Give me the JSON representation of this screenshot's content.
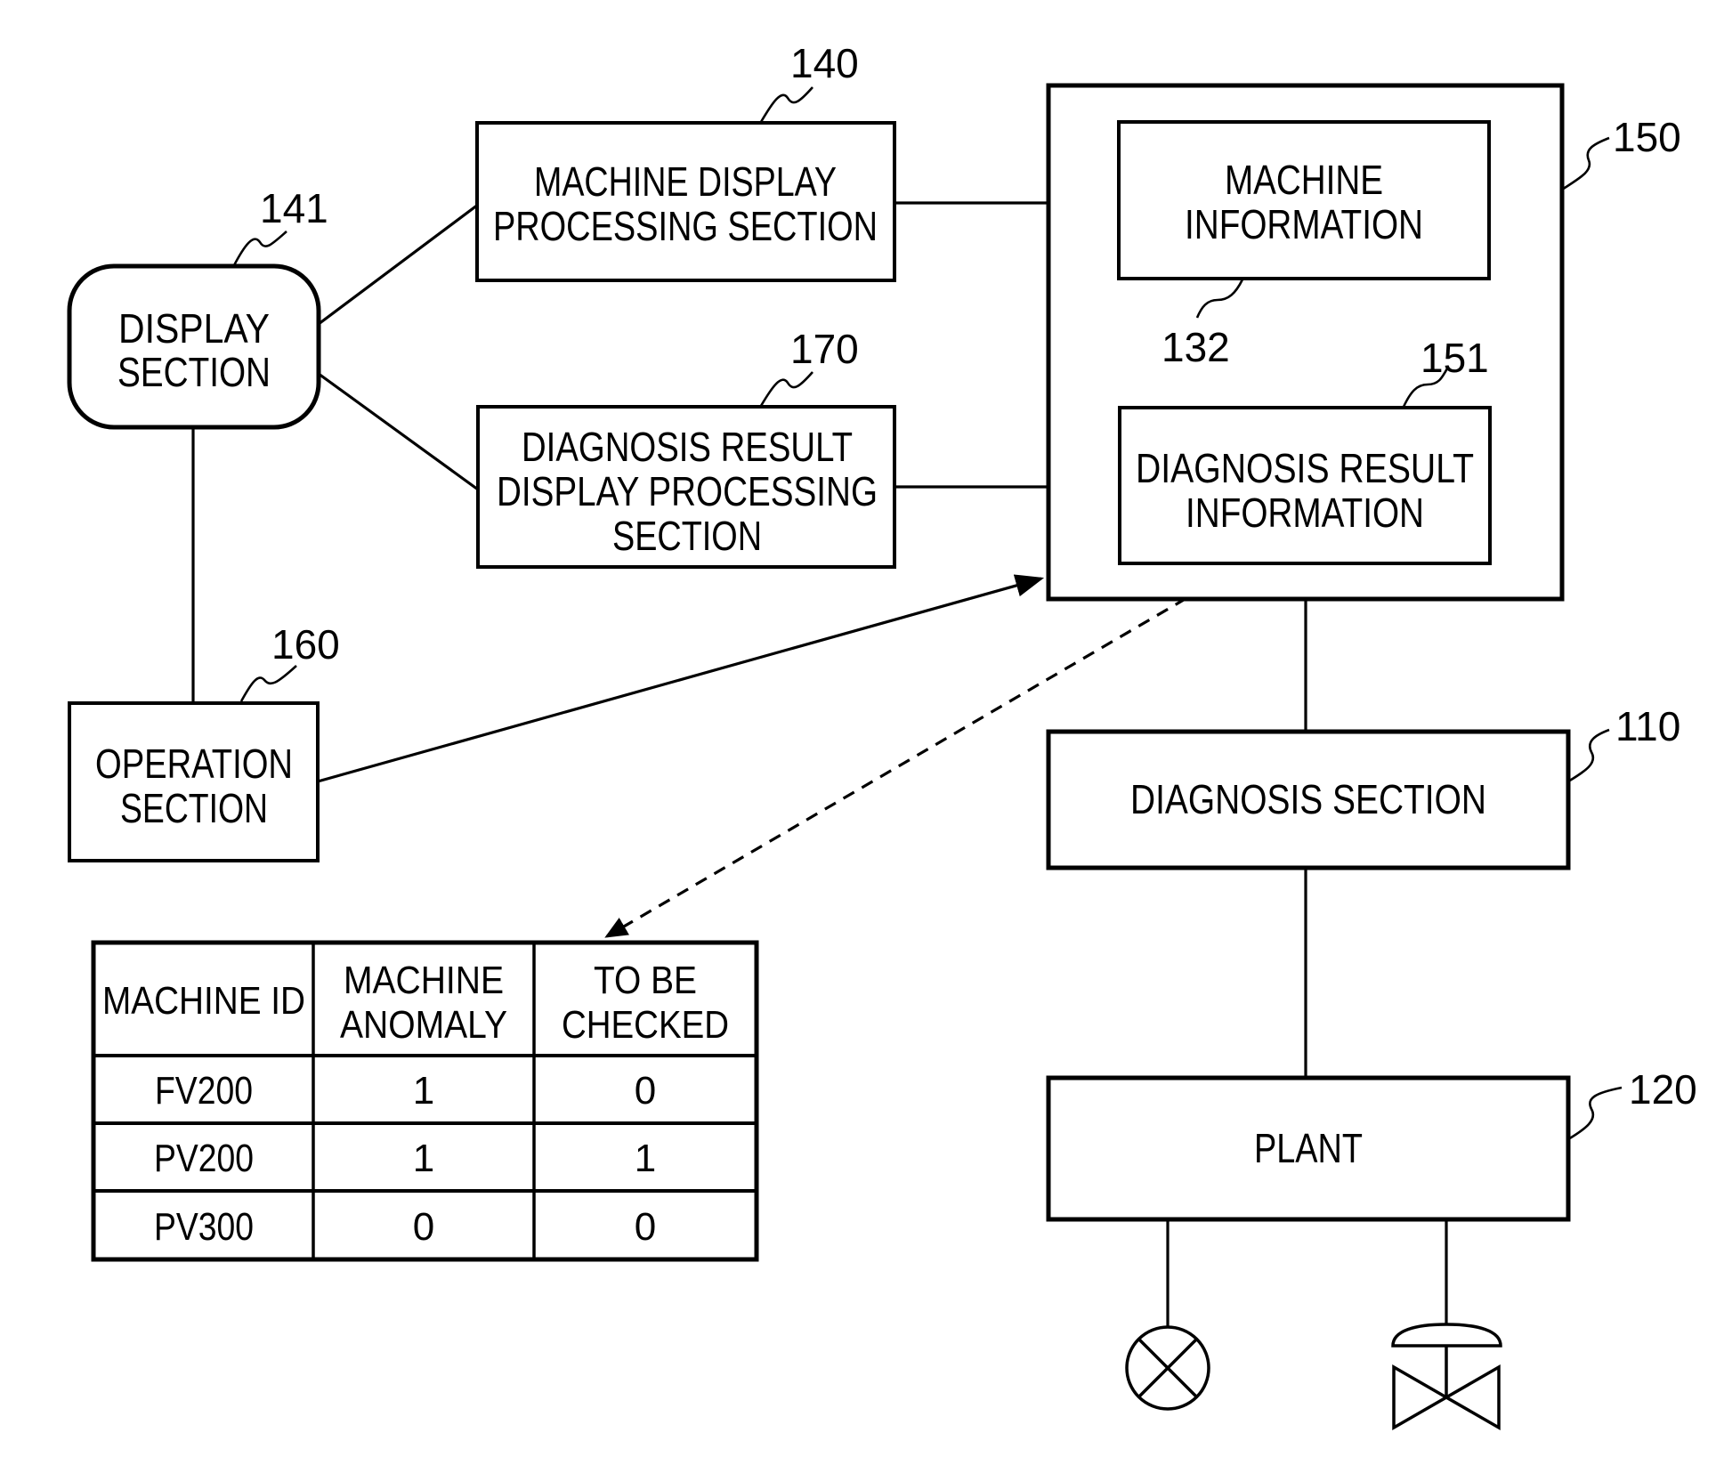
{
  "blocks": {
    "display_section": {
      "ref": "141",
      "lines": [
        "DISPLAY",
        "SECTION"
      ]
    },
    "machine_display_processing": {
      "ref": "140",
      "lines": [
        "MACHINE DISPLAY",
        "PROCESSING SECTION"
      ]
    },
    "diagnosis_result_display_processing": {
      "ref": "170",
      "lines": [
        "DIAGNOSIS RESULT",
        "DISPLAY PROCESSING",
        "SECTION"
      ]
    },
    "operation_section": {
      "ref": "160",
      "lines": [
        "OPERATION",
        "SECTION"
      ]
    },
    "storage": {
      "ref": "150"
    },
    "machine_information": {
      "ref": "132",
      "lines": [
        "MACHINE",
        "INFORMATION"
      ]
    },
    "diagnosis_result_information": {
      "ref": "151",
      "lines": [
        "DIAGNOSIS RESULT",
        "INFORMATION"
      ]
    },
    "diagnosis_section": {
      "ref": "110",
      "lines": [
        "DIAGNOSIS SECTION"
      ]
    },
    "plant": {
      "ref": "120",
      "lines": [
        "PLANT"
      ]
    }
  },
  "table": {
    "headers": [
      [
        "MACHINE ID"
      ],
      [
        "MACHINE",
        "ANOMALY"
      ],
      [
        "TO BE",
        "CHECKED"
      ]
    ],
    "rows": [
      [
        "FV200",
        "1",
        "0"
      ],
      [
        "PV200",
        "1",
        "1"
      ],
      [
        "PV300",
        "0",
        "0"
      ]
    ]
  },
  "symbols": {
    "sensor": "sensor-x-circle-icon",
    "valve": "control-valve-icon"
  }
}
